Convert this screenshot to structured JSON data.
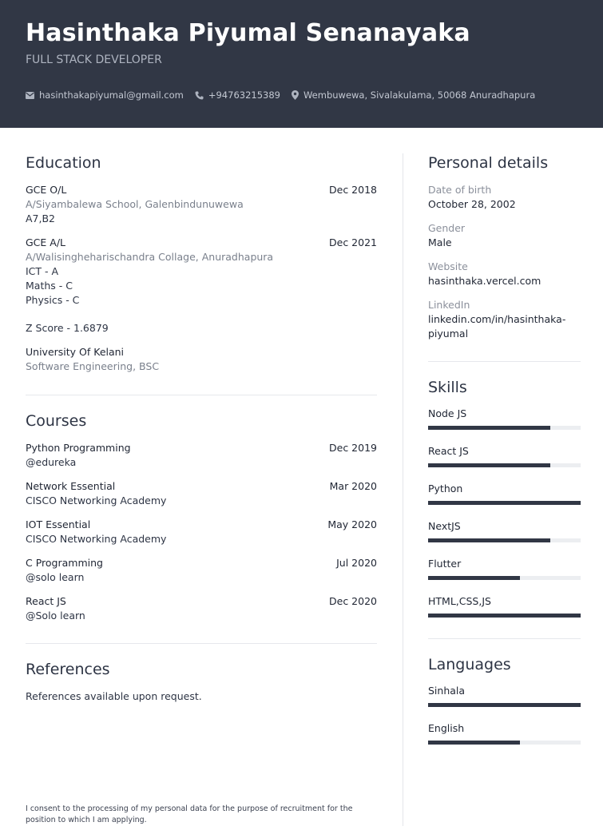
{
  "header": {
    "name": "Hasinthaka Piyumal Senanayaka",
    "role": "FULL STACK DEVELOPER",
    "email": "hasinthakapiyumal@gmail.com",
    "phone": "+94763215389",
    "address": "Wembuwewa, Sivalakulama, 50068 Anuradhapura"
  },
  "education": {
    "title": "Education",
    "ol": {
      "title": "GCE O/L",
      "date": "Dec 2018",
      "school": "A/Siyambalewa School, Galenbindunuwewa",
      "result": "A7,B2"
    },
    "al": {
      "title": "GCE A/L",
      "date": "Dec 2021",
      "school": "A/Walisingheharischandra Collage, Anuradhapura",
      "r1": "ICT - A",
      "r2": "Maths - C",
      "r3": "Physics - C",
      "zscore": "Z Score - 1.6879"
    },
    "uni": {
      "title": "University Of Kelani",
      "degree": "Software Engineering, BSC"
    }
  },
  "courses": {
    "title": "Courses",
    "items": [
      {
        "name": "Python Programming",
        "date": "Dec 2019",
        "provider": "@edureka"
      },
      {
        "name": "Network Essential",
        "date": "Mar 2020",
        "provider": "CISCO Networking Academy"
      },
      {
        "name": "IOT Essential",
        "date": "May 2020",
        "provider": "CISCO Networking Academy"
      },
      {
        "name": "C Programming",
        "date": "Jul 2020",
        "provider": "@solo learn"
      },
      {
        "name": "React JS",
        "date": "Dec 2020",
        "provider": "@Solo learn"
      }
    ]
  },
  "references": {
    "title": "References",
    "text": "References available upon request."
  },
  "consent": "I consent to the processing of my personal data for the purpose of recruitment for the position to which I am applying.",
  "personal": {
    "title": "Personal details",
    "dob_label": "Date of birth",
    "dob": "October 28, 2002",
    "gender_label": "Gender",
    "gender": "Male",
    "website_label": "Website",
    "website": "hasinthaka.vercel.com",
    "linkedin_label": "LinkedIn",
    "linkedin_1": "linkedin.com/in/hasinthaka-",
    "linkedin_2": "piyumal"
  },
  "skills": {
    "title": "Skills",
    "items": [
      {
        "name": "Node JS",
        "level": 0.8
      },
      {
        "name": "React JS",
        "level": 0.8
      },
      {
        "name": "Python",
        "level": 1.0
      },
      {
        "name": "NextJS",
        "level": 0.8
      },
      {
        "name": "Flutter",
        "level": 0.6
      },
      {
        "name": "HTML,CSS,JS",
        "level": 1.0
      }
    ]
  },
  "languages": {
    "title": "Languages",
    "items": [
      {
        "name": "Sinhala",
        "level": 1.0
      },
      {
        "name": "English",
        "level": 0.6
      }
    ]
  },
  "colors": {
    "header_bg": "#313745",
    "bar_fill": "#313745",
    "bar_track": "#eceef1"
  },
  "icons": {
    "email": "envelope-icon",
    "phone": "phone-icon",
    "address": "map-pin-icon"
  }
}
